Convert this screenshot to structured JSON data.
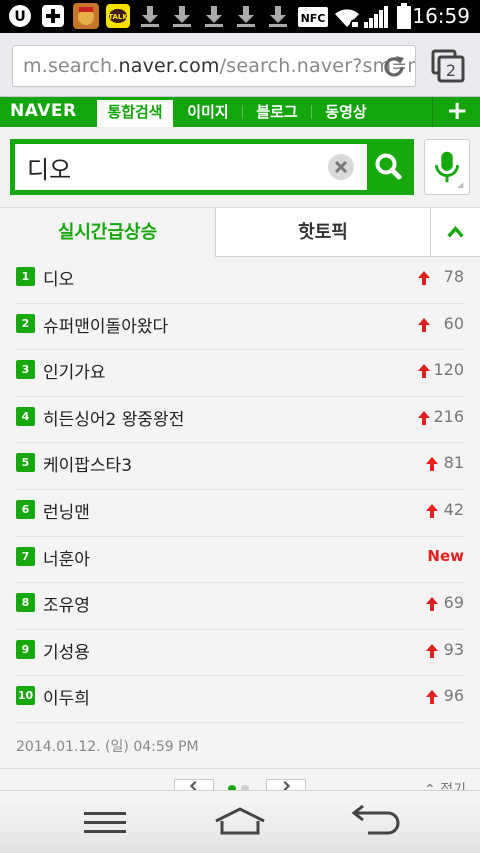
{
  "status_bar": {
    "time": "16:59",
    "icons": [
      "u-plus-icon",
      "add-icon",
      "game-app-icon",
      "kakaotalk-icon",
      "download-icon",
      "download-icon",
      "download-icon",
      "download-icon",
      "download-icon",
      "nfc-icon",
      "wifi-icon",
      "signal-icon",
      "battery-icon"
    ],
    "nfc_label": "NFC",
    "talk_label": "TALK"
  },
  "browser": {
    "url_prefix": "m.search.",
    "url_domain": "naver.com",
    "url_suffix": "/search.naver?sm=mtl",
    "tab_count": "2"
  },
  "naver_nav": {
    "logo": "NAVER",
    "tabs": [
      {
        "label": "통합검색",
        "active": true
      },
      {
        "label": "이미지",
        "active": false
      },
      {
        "label": "블로그",
        "active": false
      },
      {
        "label": "동영상",
        "active": false
      }
    ],
    "more": "+"
  },
  "search": {
    "query": "디오"
  },
  "trend": {
    "tab_realtime": "실시간급상승",
    "tab_hot": "핫토픽",
    "items": [
      {
        "rank": "1",
        "keyword": "디오",
        "change": "78",
        "is_new": false
      },
      {
        "rank": "2",
        "keyword": "슈퍼맨이돌아왔다",
        "change": "60",
        "is_new": false
      },
      {
        "rank": "3",
        "keyword": "인기가요",
        "change": "120",
        "is_new": false
      },
      {
        "rank": "4",
        "keyword": "히든싱어2 왕중왕전",
        "change": "216",
        "is_new": false
      },
      {
        "rank": "5",
        "keyword": "케이팝스타3",
        "change": "81",
        "is_new": false
      },
      {
        "rank": "6",
        "keyword": "런닝맨",
        "change": "42",
        "is_new": false
      },
      {
        "rank": "7",
        "keyword": "너훈아",
        "change": "New",
        "is_new": true
      },
      {
        "rank": "8",
        "keyword": "조유영",
        "change": "69",
        "is_new": false
      },
      {
        "rank": "9",
        "keyword": "기성용",
        "change": "93",
        "is_new": false
      },
      {
        "rank": "10",
        "keyword": "이두희",
        "change": "96",
        "is_new": false
      }
    ],
    "timestamp": "2014.01.12. (일) 04:59 PM",
    "fold_label": "접기"
  },
  "colors": {
    "naver_green": "#16a80c",
    "arrow_red": "#e31f1f"
  }
}
